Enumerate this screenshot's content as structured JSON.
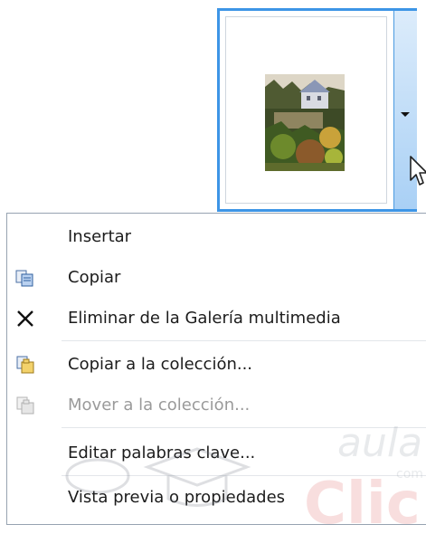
{
  "gallery_item": {
    "thumbnail_icon": "landscape-photo-icon",
    "dropdown_icon": "chevron-down-icon",
    "cursor_icon": "mouse-pointer-icon"
  },
  "menu": {
    "items": [
      {
        "label": "Insertar",
        "icon": "",
        "enabled": true
      },
      {
        "label": "Copiar",
        "icon": "copy-icon",
        "enabled": true
      },
      {
        "label": "Eliminar de la Galería multimedia",
        "icon": "close-icon",
        "enabled": true
      },
      {
        "label": "Copiar a la colección...",
        "icon": "copy-to-collection-icon",
        "enabled": true
      },
      {
        "label": "Mover a la colección...",
        "icon": "move-to-collection-icon",
        "enabled": false
      },
      {
        "label": "Editar palabras clave...",
        "icon": "",
        "enabled": true
      },
      {
        "label": "Vista previa o propiedades",
        "icon": "",
        "enabled": true
      }
    ]
  },
  "watermark": {
    "brand": "aula",
    "domain": "com",
    "suffix": "Clic"
  },
  "colors": {
    "selection_border": "#3d95e6",
    "dropdown_fill": "#a9d0f5",
    "menu_border": "#97a3b1",
    "disabled_text": "#9a9a9a"
  }
}
